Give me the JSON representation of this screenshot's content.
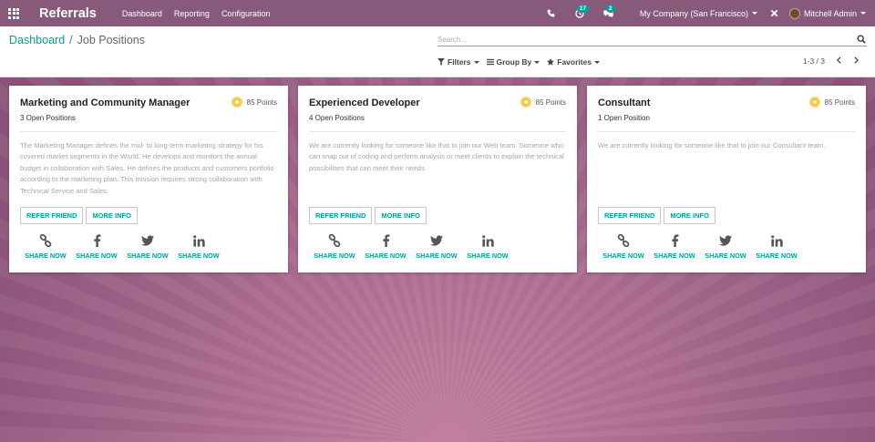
{
  "navbar": {
    "brand": "Referrals",
    "menu": [
      "Dashboard",
      "Reporting",
      "Configuration"
    ],
    "activity_count": "17",
    "messages_count": "2",
    "company": "My Company (San Francisco)",
    "user": "Mitchell Admin"
  },
  "breadcrumb": {
    "parent": "Dashboard",
    "separator": "/",
    "current": "Job Positions"
  },
  "search": {
    "placeholder": "Search..."
  },
  "filters": {
    "filters_label": "Filters",
    "group_by_label": "Group By",
    "favorites_label": "Favorites"
  },
  "pager": {
    "value": "1-3 / 3"
  },
  "cards": [
    {
      "title": "Marketing and Community Manager",
      "positions": "3 Open Positions",
      "points": "85 Points",
      "description": "The Marketing Manager defines the mid- to long-term marketing strategy for his covered market segments in the World. He develops and monitors the annual budget in collaboration with Sales. He defines the products and customers portfolio according to the marketing plan. This mission requires strong collaboration with Technical Service and Sales.",
      "refer_label": "REFER FRIEND",
      "info_label": "MORE INFO"
    },
    {
      "title": "Experienced Developer",
      "positions": "4 Open Positions",
      "points": "85 Points",
      "description": "We are currently looking for someone like that to join our Web team. Someone who can snap out of coding and perform analysis or meet clients to explain the technical possibilities that can meet their needs.",
      "refer_label": "REFER FRIEND",
      "info_label": "MORE INFO"
    },
    {
      "title": "Consultant",
      "positions": "1 Open Position",
      "points": "85 Points",
      "description": "We are currently looking for someone like that to join our Consultant team.",
      "refer_label": "REFER FRIEND",
      "info_label": "MORE INFO"
    }
  ],
  "share": {
    "labels": [
      "SHARE NOW",
      "SHARE NOW",
      "SHARE NOW",
      "SHARE NOW"
    ],
    "icons": [
      "link-icon",
      "facebook-icon",
      "twitter-icon",
      "linkedin-icon"
    ]
  },
  "colors": {
    "navbar": "#875a7b",
    "accent": "#00a09d",
    "background": "#a05f82",
    "coin": "#f3c43b"
  }
}
